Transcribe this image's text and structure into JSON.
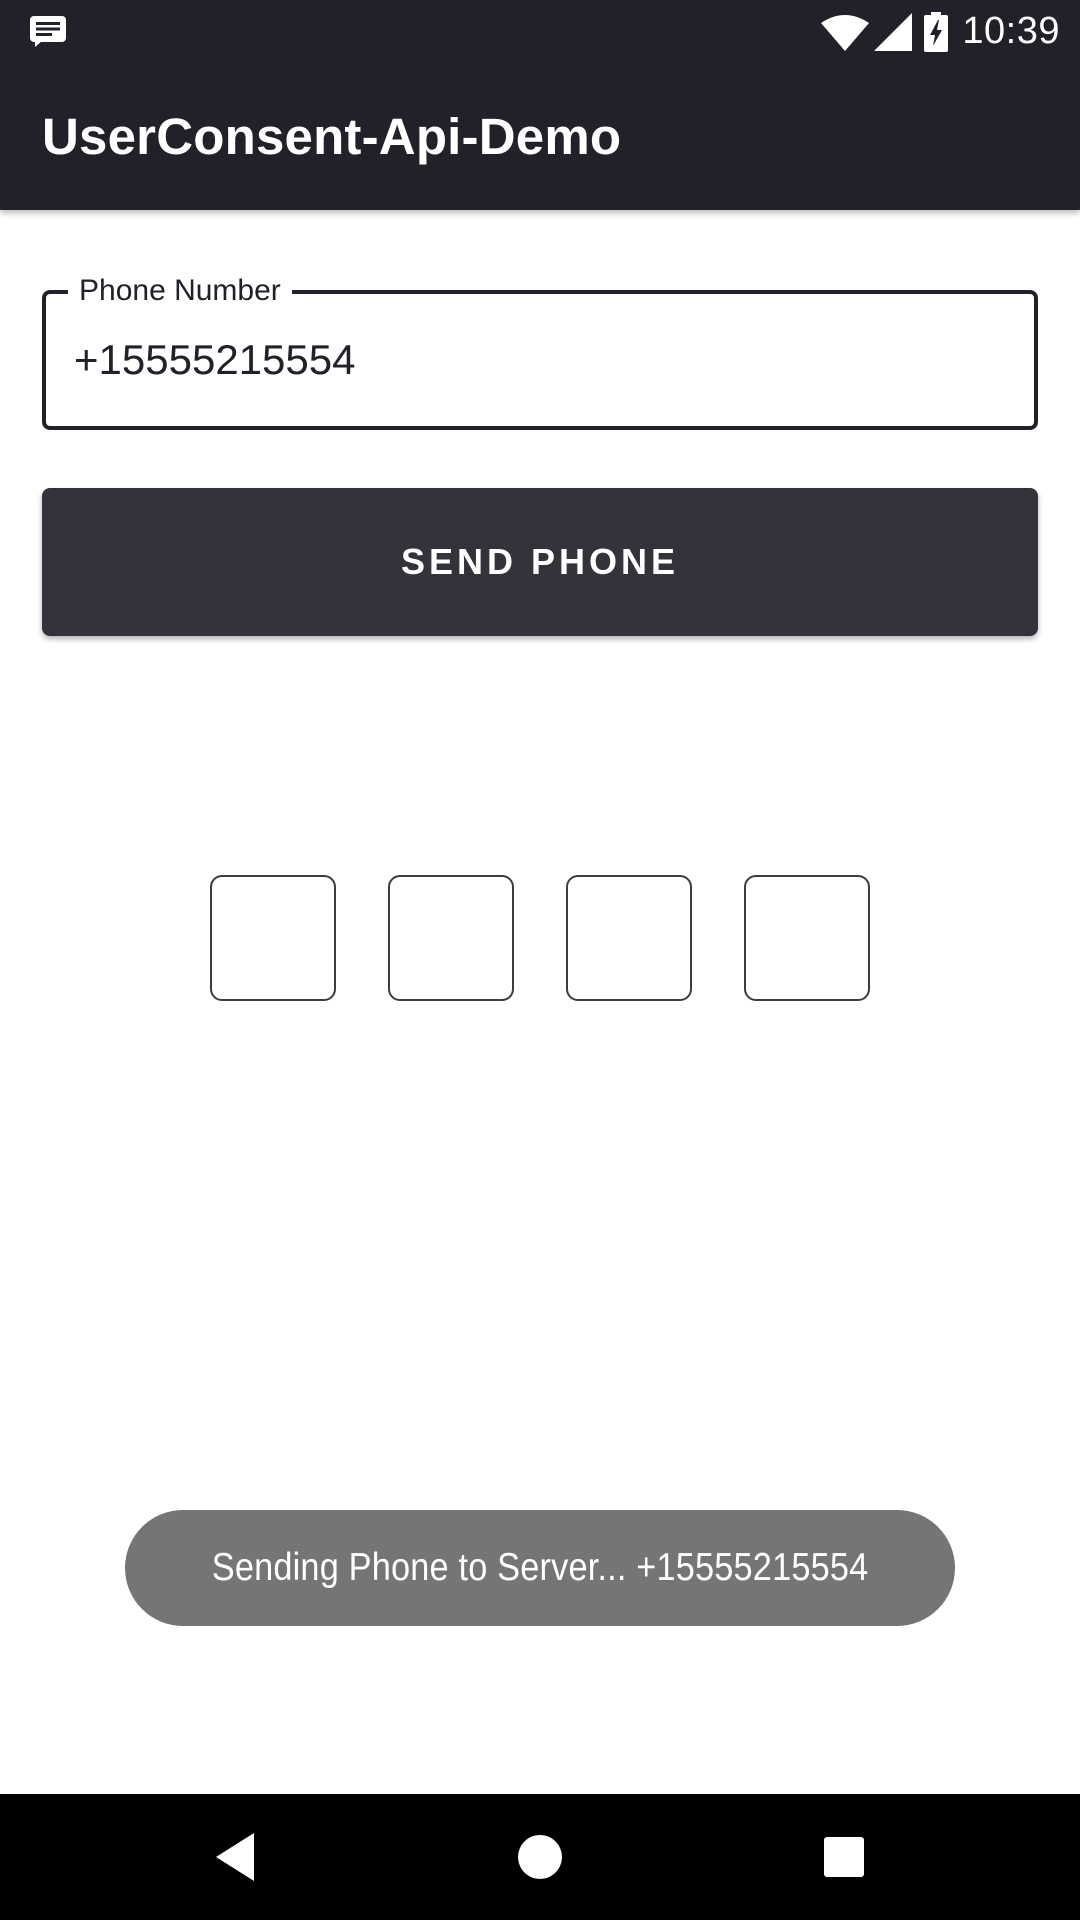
{
  "status_bar": {
    "time": "10:39",
    "icons": [
      "notification-icon",
      "wifi-icon",
      "signal-icon",
      "battery-charging-icon"
    ]
  },
  "app_bar": {
    "title": "UserConsent-Api-Demo"
  },
  "phone_field": {
    "label": "Phone Number",
    "value": "+15555215554"
  },
  "send_button": {
    "label": "SEND PHONE"
  },
  "otp": {
    "digits": [
      "",
      "",
      "",
      ""
    ]
  },
  "toast": {
    "message": "Sending Phone to Server... +15555215554"
  },
  "nav_bar": {
    "icons": [
      "back-icon",
      "home-icon",
      "recents-icon"
    ]
  },
  "colors": {
    "app_bar": "#202129",
    "button": "#32333b",
    "toast": "#757575"
  }
}
